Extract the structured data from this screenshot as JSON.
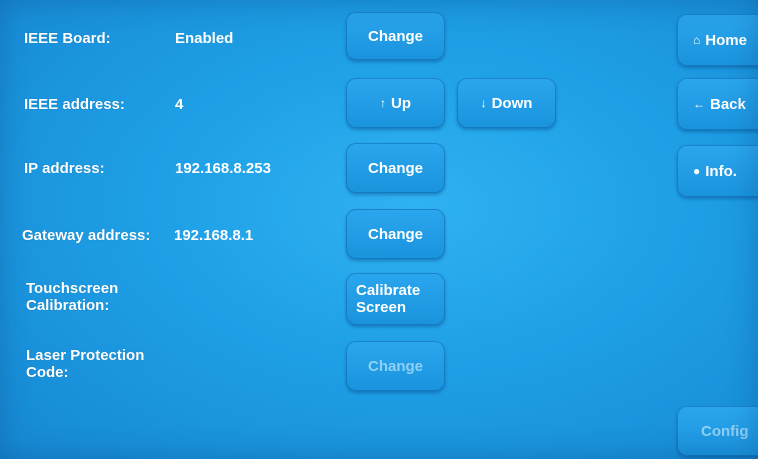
{
  "rows": [
    {
      "label": "IEEE Board:",
      "value": "Enabled",
      "button": "Change"
    },
    {
      "label": "IEEE address:",
      "value": "4",
      "up": "Up",
      "down": "Down"
    },
    {
      "label": "IP address:",
      "value": "192.168.8.253",
      "button": "Change"
    },
    {
      "label": "Gateway address:",
      "value": "192.168.8.1",
      "button": "Change"
    },
    {
      "label_line1": "Touchscreen",
      "label_line2": "Calibration:",
      "button_line1": "Calibrate",
      "button_line2": "Screen"
    },
    {
      "label_line1": "Laser Protection",
      "label_line2": "Code:",
      "button": "Change",
      "button_state": "disabled"
    }
  ],
  "nav": {
    "home": "Home",
    "back": "Back",
    "info": "Info.",
    "config": "Config"
  },
  "icons": {
    "up": "arrow-up-icon",
    "down": "arrow-down-icon",
    "home": "house-icon",
    "back": "arrow-left-icon",
    "info": "lightbulb-icon"
  },
  "colors": {
    "background": "#1e9fe6",
    "button": "#1a93dd",
    "disabled_text": "#8fd0f5"
  }
}
